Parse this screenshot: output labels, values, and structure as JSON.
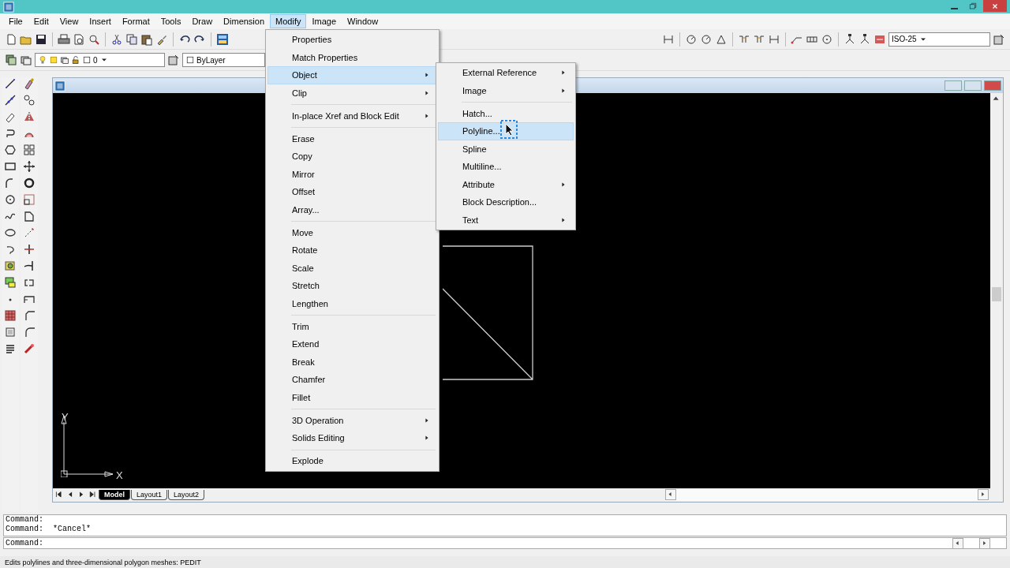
{
  "menu_bar": [
    {
      "label": "File",
      "selected": false
    },
    {
      "label": "Edit",
      "selected": false
    },
    {
      "label": "View",
      "selected": false
    },
    {
      "label": "Insert",
      "selected": false
    },
    {
      "label": "Format",
      "selected": false
    },
    {
      "label": "Tools",
      "selected": false
    },
    {
      "label": "Draw",
      "selected": false
    },
    {
      "label": "Dimension",
      "selected": false
    },
    {
      "label": "Modify",
      "selected": true
    },
    {
      "label": "Image",
      "selected": false
    },
    {
      "label": "Window",
      "selected": false
    }
  ],
  "standard_toolbar": {
    "dim_style": "ISO-25"
  },
  "properties_toolbar": {
    "layer": "0",
    "color_setting": "ByLayer"
  },
  "drawing_window": {
    "ucs": {
      "x_label": "X",
      "y_label": "Y"
    },
    "tabs": [
      {
        "label": "Model",
        "selected": true
      },
      {
        "label": "Layout1",
        "selected": false
      },
      {
        "label": "Layout2",
        "selected": false
      }
    ]
  },
  "modify_menu": {
    "items": [
      {
        "kind": "item",
        "label": "Properties",
        "submenu": false,
        "selected": false
      },
      {
        "kind": "item",
        "label": "Match Properties",
        "submenu": false,
        "selected": false
      },
      {
        "kind": "item",
        "label": "Object",
        "submenu": true,
        "selected": true
      },
      {
        "kind": "item",
        "label": "Clip",
        "submenu": true,
        "selected": false
      },
      {
        "kind": "separator"
      },
      {
        "kind": "item",
        "label": "In-place Xref and Block Edit",
        "submenu": true,
        "selected": false
      },
      {
        "kind": "separator"
      },
      {
        "kind": "item",
        "label": "Erase",
        "submenu": false,
        "selected": false
      },
      {
        "kind": "item",
        "label": "Copy",
        "submenu": false,
        "selected": false
      },
      {
        "kind": "item",
        "label": "Mirror",
        "submenu": false,
        "selected": false
      },
      {
        "kind": "item",
        "label": "Offset",
        "submenu": false,
        "selected": false
      },
      {
        "kind": "item",
        "label": "Array...",
        "submenu": false,
        "selected": false
      },
      {
        "kind": "separator"
      },
      {
        "kind": "item",
        "label": "Move",
        "submenu": false,
        "selected": false
      },
      {
        "kind": "item",
        "label": "Rotate",
        "submenu": false,
        "selected": false
      },
      {
        "kind": "item",
        "label": "Scale",
        "submenu": false,
        "selected": false
      },
      {
        "kind": "item",
        "label": "Stretch",
        "submenu": false,
        "selected": false
      },
      {
        "kind": "item",
        "label": "Lengthen",
        "submenu": false,
        "selected": false
      },
      {
        "kind": "separator"
      },
      {
        "kind": "item",
        "label": "Trim",
        "submenu": false,
        "selected": false
      },
      {
        "kind": "item",
        "label": "Extend",
        "submenu": false,
        "selected": false
      },
      {
        "kind": "item",
        "label": "Break",
        "submenu": false,
        "selected": false
      },
      {
        "kind": "item",
        "label": "Chamfer",
        "submenu": false,
        "selected": false
      },
      {
        "kind": "item",
        "label": "Fillet",
        "submenu": false,
        "selected": false
      },
      {
        "kind": "separator"
      },
      {
        "kind": "item",
        "label": "3D Operation",
        "submenu": true,
        "selected": false
      },
      {
        "kind": "item",
        "label": "Solids Editing",
        "submenu": true,
        "selected": false
      },
      {
        "kind": "separator"
      },
      {
        "kind": "item",
        "label": "Explode",
        "submenu": false,
        "selected": false
      }
    ]
  },
  "object_submenu": {
    "items": [
      {
        "kind": "item",
        "label": "External Reference",
        "submenu": true,
        "selected": false
      },
      {
        "kind": "item",
        "label": "Image",
        "submenu": true,
        "selected": false
      },
      {
        "kind": "separator"
      },
      {
        "kind": "item",
        "label": "Hatch...",
        "submenu": false,
        "selected": false
      },
      {
        "kind": "item",
        "label": "Polyline...",
        "submenu": false,
        "selected": true
      },
      {
        "kind": "item",
        "label": "Spline",
        "submenu": false,
        "selected": false
      },
      {
        "kind": "item",
        "label": "Multiline...",
        "submenu": false,
        "selected": false
      },
      {
        "kind": "item",
        "label": "Attribute",
        "submenu": true,
        "selected": false
      },
      {
        "kind": "item",
        "label": "Block Description...",
        "submenu": false,
        "selected": false
      },
      {
        "kind": "item",
        "label": "Text",
        "submenu": true,
        "selected": false
      }
    ]
  },
  "command_history": [
    "Command:",
    "Command:  *Cancel*"
  ],
  "command_prompt": "Command:",
  "status_bar": {
    "text": "Edits polylines and three-dimensional polygon meshes:  PEDIT"
  }
}
